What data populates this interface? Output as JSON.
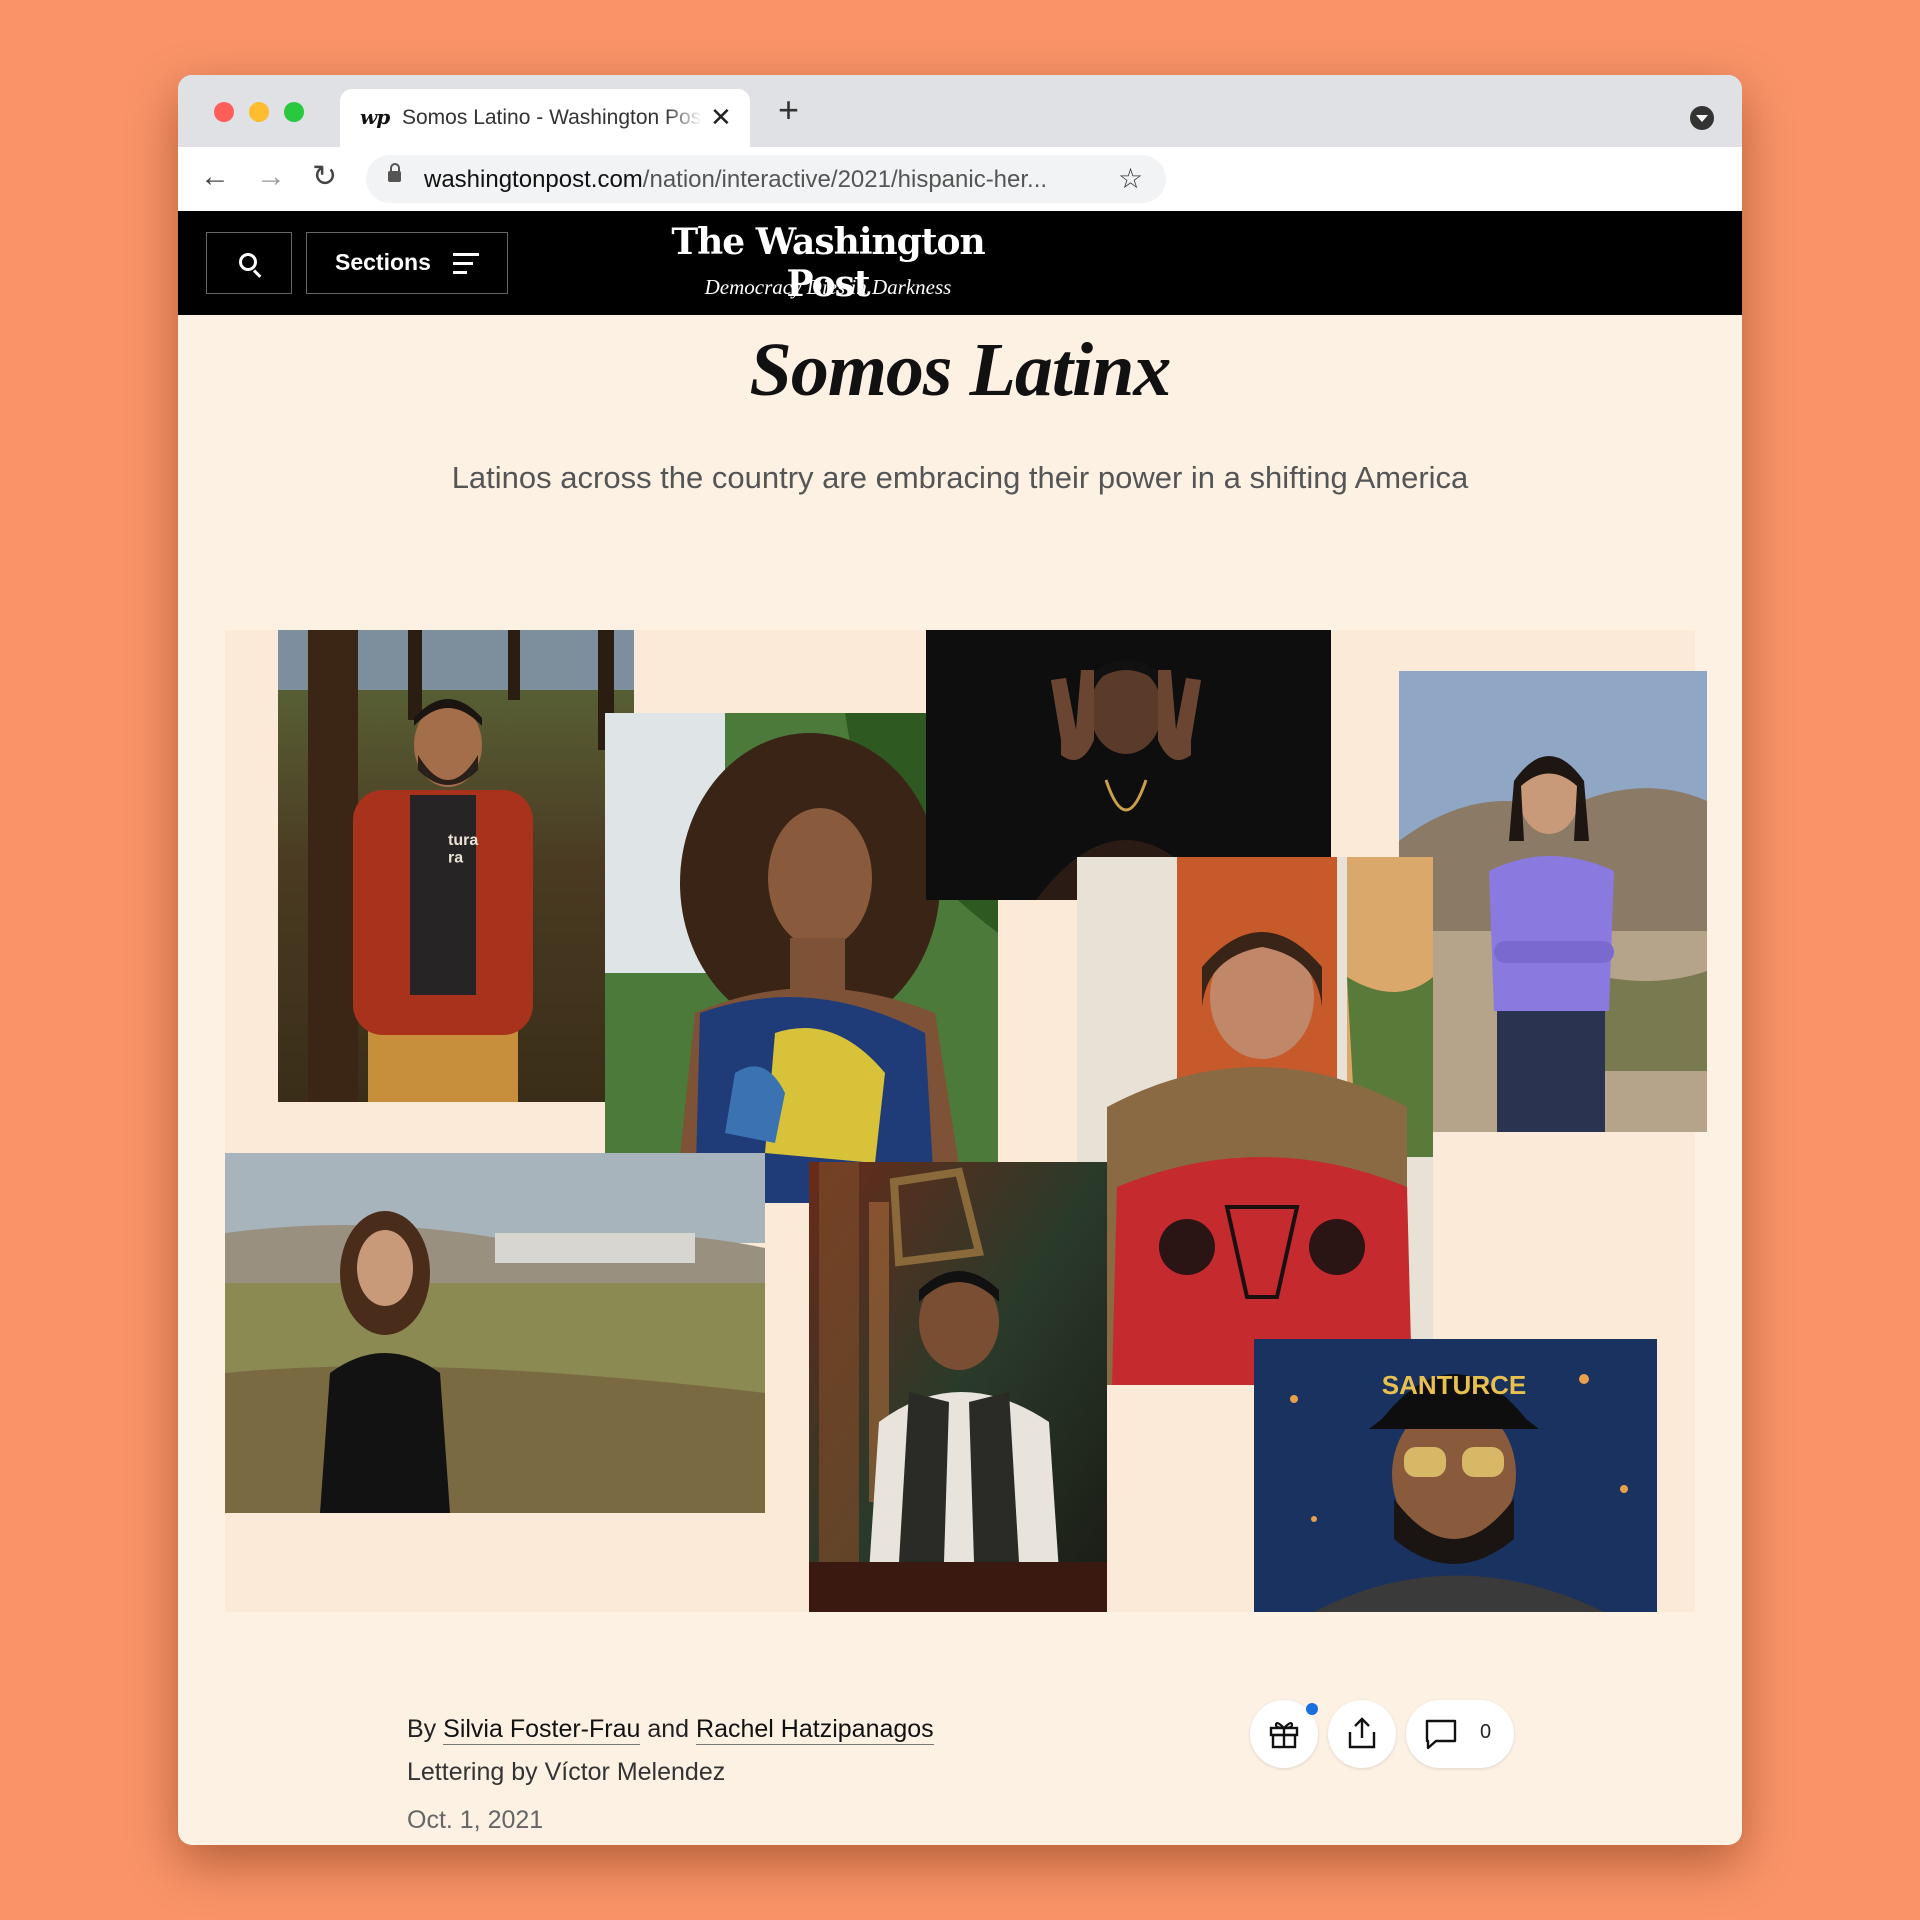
{
  "browser": {
    "tab": {
      "favicon_text": "wp",
      "title": "Somos Latino - Washington Post",
      "close_glyph": "✕"
    },
    "new_tab_glyph": "+",
    "nav": {
      "back_glyph": "←",
      "forward_glyph": "→",
      "reload_glyph": "↻"
    },
    "url": {
      "host": "washingtonpost.com",
      "path": "/nation/interactive/2021/hispanic-her..."
    },
    "bookmark_glyph": "☆",
    "icons": [
      "lock-icon",
      "star-icon",
      "profile-menu-icon"
    ]
  },
  "masthead": {
    "sections_label": "Sections",
    "logo": "The Washington Post",
    "tagline": "Democracy Dies in Darkness",
    "icons": [
      "search-icon",
      "hamburger-menu-icon"
    ]
  },
  "article": {
    "headline": "Somos Latinx",
    "dek": "Latinos across the country are embracing their power in a shifting America",
    "byline": {
      "prefix": "By",
      "author1": "Silvia Foster-Frau",
      "conjunction": "and",
      "author2": "Rachel Hatzipanagos"
    },
    "lettering": "Lettering by Víctor Melendez",
    "date": "Oct. 1, 2021",
    "comment_count": "0",
    "photo_text": {
      "shirt": "tura\nra",
      "cap": "SANTURCE"
    }
  },
  "colors": {
    "page_background": "#fa9468",
    "article_background": "#fdf1e4",
    "masthead": "#000000",
    "notification_dot": "#1a6fe0"
  }
}
